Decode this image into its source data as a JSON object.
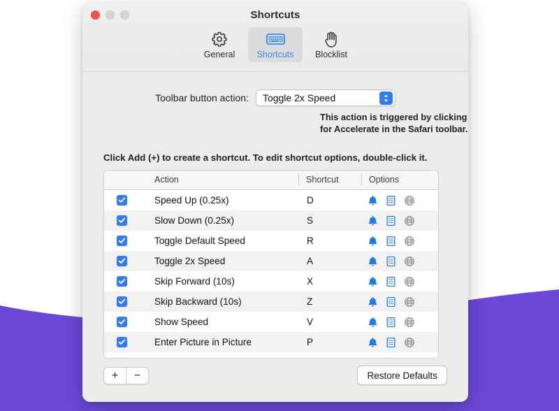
{
  "background": {
    "base_color": "#ffffff",
    "accent_color": "#6b48d8"
  },
  "window": {
    "title": "Shortcuts",
    "traffic_lights": [
      {
        "name": "close",
        "color": "#f2544a"
      },
      {
        "name": "minimize",
        "color": "#d4d4d4"
      },
      {
        "name": "zoom",
        "color": "#d4d4d4"
      }
    ],
    "tabs": [
      {
        "label": "General",
        "icon": "gear-icon",
        "selected": false
      },
      {
        "label": "Shortcuts",
        "icon": "keyboard-icon",
        "selected": true
      },
      {
        "label": "Blocklist",
        "icon": "hand-icon",
        "selected": false
      }
    ]
  },
  "toolbar_action": {
    "label": "Toolbar button action:",
    "selected_value": "Toggle 2x Speed",
    "options": [
      "Toggle 2x Speed",
      "Speed Up (0.25x)",
      "Slow Down (0.25x)",
      "Toggle Default Speed",
      "Skip Forward (10s)",
      "Skip Backward (10s)",
      "Show Speed",
      "Enter Picture in Picture"
    ],
    "hint_line_1": "This action is triggered by clicking the button",
    "hint_line_2": "for Accelerate in the Safari toolbar."
  },
  "list_hint": "Click Add (+) to create a shortcut. To edit shortcut options, double-click it.",
  "table": {
    "columns": [
      "",
      "Action",
      "Shortcut",
      "Options"
    ],
    "option_icons": [
      "bell-icon",
      "note-icon",
      "globe-icon"
    ],
    "rows": [
      {
        "enabled": true,
        "action": "Speed Up (0.25x)",
        "shortcut": "D"
      },
      {
        "enabled": true,
        "action": "Slow Down (0.25x)",
        "shortcut": "S"
      },
      {
        "enabled": true,
        "action": "Toggle Default Speed",
        "shortcut": "R"
      },
      {
        "enabled": true,
        "action": "Toggle 2x Speed",
        "shortcut": "A"
      },
      {
        "enabled": true,
        "action": "Skip Forward (10s)",
        "shortcut": "X"
      },
      {
        "enabled": true,
        "action": "Skip Backward (10s)",
        "shortcut": "Z"
      },
      {
        "enabled": true,
        "action": "Show Speed",
        "shortcut": "V"
      },
      {
        "enabled": true,
        "action": "Enter Picture in Picture",
        "shortcut": "P"
      }
    ]
  },
  "footer": {
    "add_label": "+",
    "remove_label": "−",
    "restore_label": "Restore Defaults"
  }
}
